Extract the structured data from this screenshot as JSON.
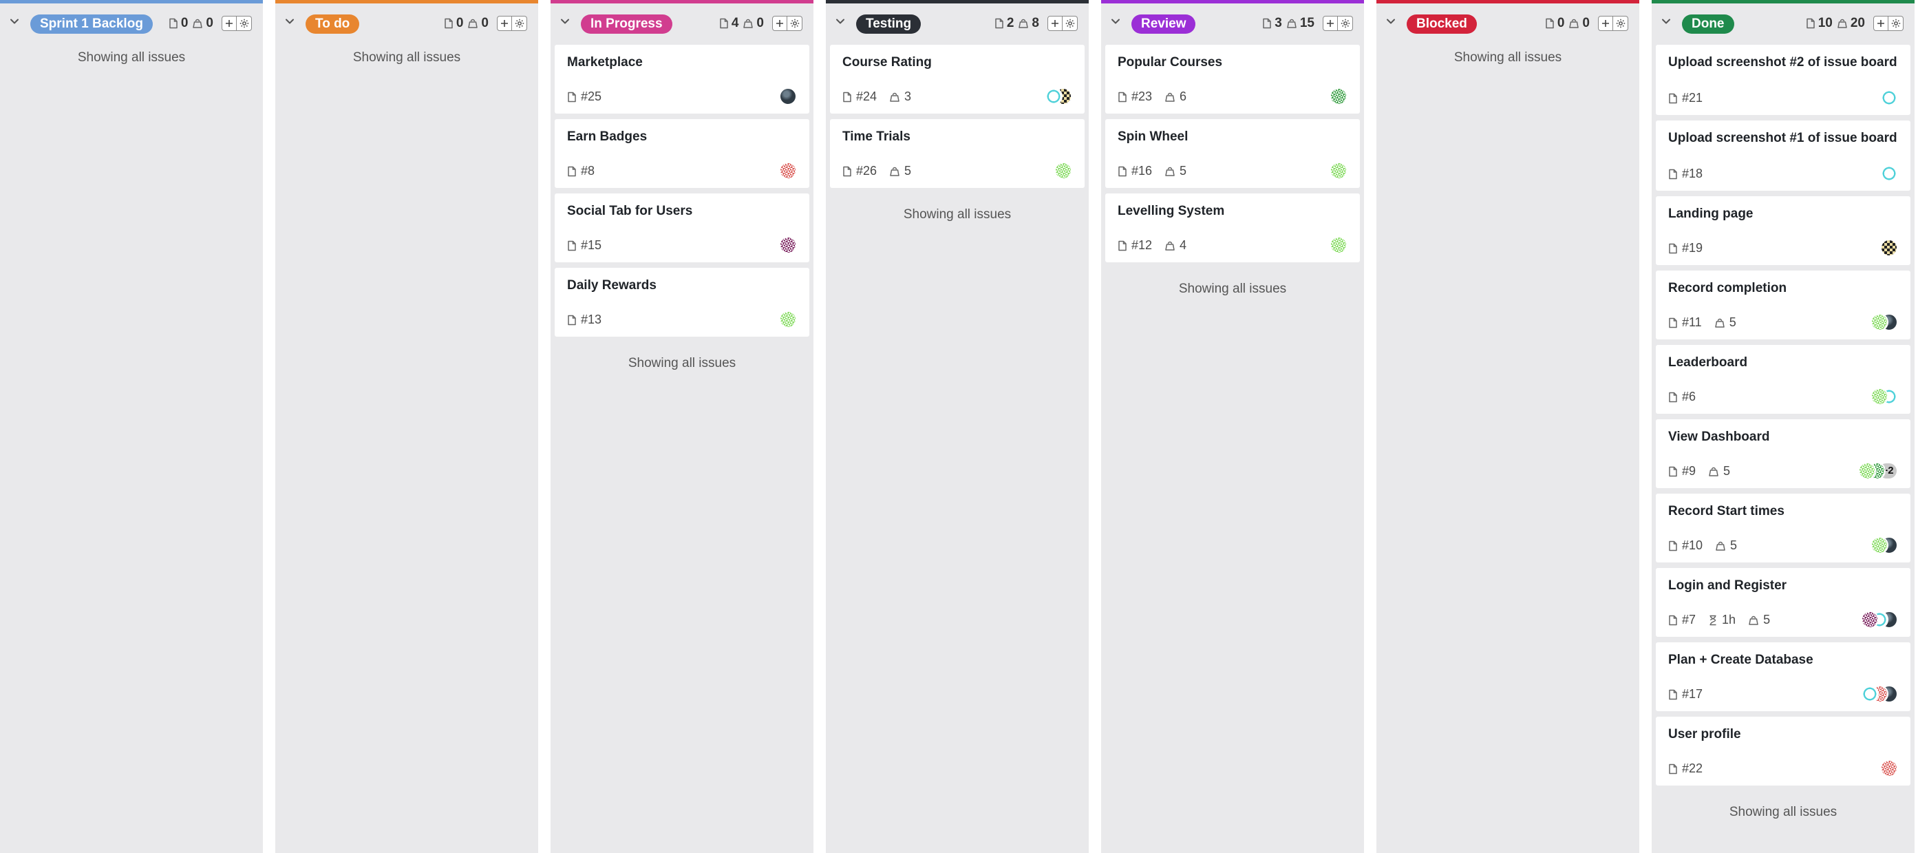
{
  "colors": {
    "sprint": "#6a9bd8",
    "todo": "#e8862f",
    "inprogress": "#d13d8f",
    "testing": "#2b2f36",
    "review": "#9b2fd6",
    "blocked": "#d3233b",
    "done": "#1f8a4c"
  },
  "columns": [
    {
      "key": "sprint",
      "label": "Sprint 1 Backlog",
      "issues": "0",
      "points": "0",
      "showing": "Showing all issues",
      "cards": []
    },
    {
      "key": "todo",
      "label": "To do",
      "issues": "0",
      "points": "0",
      "showing": "Showing all issues",
      "cards": []
    },
    {
      "key": "inprogress",
      "label": "In Progress",
      "issues": "4",
      "points": "0",
      "showing": "Showing all issues",
      "cards": [
        {
          "title": "Marketplace",
          "num": "#25",
          "points": "",
          "time": "",
          "avatars": [
            "dark"
          ]
        },
        {
          "title": "Earn Badges",
          "num": "#8",
          "points": "",
          "time": "",
          "avatars": [
            "red"
          ]
        },
        {
          "title": "Social Tab for Users",
          "num": "#15",
          "points": "",
          "time": "",
          "avatars": [
            "purple"
          ]
        },
        {
          "title": "Daily Rewards",
          "num": "#13",
          "points": "",
          "time": "",
          "avatars": [
            "green"
          ]
        }
      ]
    },
    {
      "key": "testing",
      "label": "Testing",
      "issues": "2",
      "points": "8",
      "showing": "Showing all issues",
      "cards": [
        {
          "title": "Course Rating",
          "num": "#24",
          "points": "3",
          "time": "",
          "avatars": [
            "cyan",
            "checker"
          ]
        },
        {
          "title": "Time Trials",
          "num": "#26",
          "points": "5",
          "time": "",
          "avatars": [
            "green"
          ]
        }
      ]
    },
    {
      "key": "review",
      "label": "Review",
      "issues": "3",
      "points": "15",
      "showing": "Showing all issues",
      "cards": [
        {
          "title": "Popular Courses",
          "num": "#23",
          "points": "6",
          "time": "",
          "avatars": [
            "dgreen"
          ]
        },
        {
          "title": "Spin Wheel",
          "num": "#16",
          "points": "5",
          "time": "",
          "avatars": [
            "green"
          ]
        },
        {
          "title": "Levelling System",
          "num": "#12",
          "points": "4",
          "time": "",
          "avatars": [
            "green"
          ]
        }
      ]
    },
    {
      "key": "blocked",
      "label": "Blocked",
      "issues": "0",
      "points": "0",
      "showing": "Showing all issues",
      "cards": []
    },
    {
      "key": "done",
      "label": "Done",
      "issues": "10",
      "points": "20",
      "showing": "Showing all issues",
      "cards": [
        {
          "title": "Upload screenshot #2 of issue board",
          "num": "#21",
          "points": "",
          "time": "",
          "avatars": [
            "cyan"
          ]
        },
        {
          "title": "Upload screenshot #1 of issue board",
          "num": "#18",
          "points": "",
          "time": "",
          "avatars": [
            "cyan"
          ]
        },
        {
          "title": "Landing page",
          "num": "#19",
          "points": "",
          "time": "",
          "avatars": [
            "checker"
          ]
        },
        {
          "title": "Record completion",
          "num": "#11",
          "points": "5",
          "time": "",
          "avatars": [
            "green",
            "dark"
          ]
        },
        {
          "title": "Leaderboard",
          "num": "#6",
          "points": "",
          "time": "",
          "avatars": [
            "green",
            "cyan"
          ]
        },
        {
          "title": "View Dashboard",
          "num": "#9",
          "points": "5",
          "time": "",
          "avatars": [
            "green",
            "dgreen"
          ],
          "more": "+2"
        },
        {
          "title": "Record Start times",
          "num": "#10",
          "points": "5",
          "time": "",
          "avatars": [
            "green",
            "dark"
          ]
        },
        {
          "title": "Login and Register",
          "num": "#7",
          "points": "5",
          "time": "1h",
          "avatars": [
            "purple",
            "cyan",
            "dark"
          ]
        },
        {
          "title": "Plan + Create Database",
          "num": "#17",
          "points": "",
          "time": "",
          "avatars": [
            "cyan",
            "red",
            "dark"
          ]
        },
        {
          "title": "User profile",
          "num": "#22",
          "points": "",
          "time": "",
          "avatars": [
            "red"
          ]
        }
      ]
    }
  ],
  "avatar_colors": {
    "dark": "#2f3b45",
    "red": "#d9534f",
    "purple": "#7a1f5c",
    "green": "#7ed957",
    "dgreen": "#2e9a3a",
    "cyan": "#4fd1d9",
    "checker": "#222222"
  }
}
